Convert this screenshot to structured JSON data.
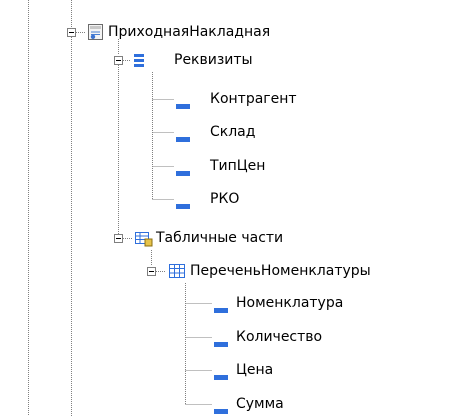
{
  "tree": {
    "root": {
      "label": "ПриходнаяНакладная",
      "icon": "document-icon"
    },
    "requisites": {
      "label": "Реквизиты",
      "icon": "requisites-folder-icon",
      "items": [
        "Контрагент",
        "Склад",
        "ТипЦен",
        "РКО"
      ]
    },
    "tabular": {
      "label": "Табличные части",
      "icon": "tabular-parts-icon",
      "table": {
        "label": "ПереченьНоменклатуры",
        "icon": "table-icon",
        "items": [
          "Номенклатура",
          "Количество",
          "Цена",
          "Сумма"
        ]
      }
    }
  },
  "colors": {
    "attribute_icon": "#2f6fdc",
    "tree_line": "#7f7f7f",
    "background": "#ffffff"
  }
}
